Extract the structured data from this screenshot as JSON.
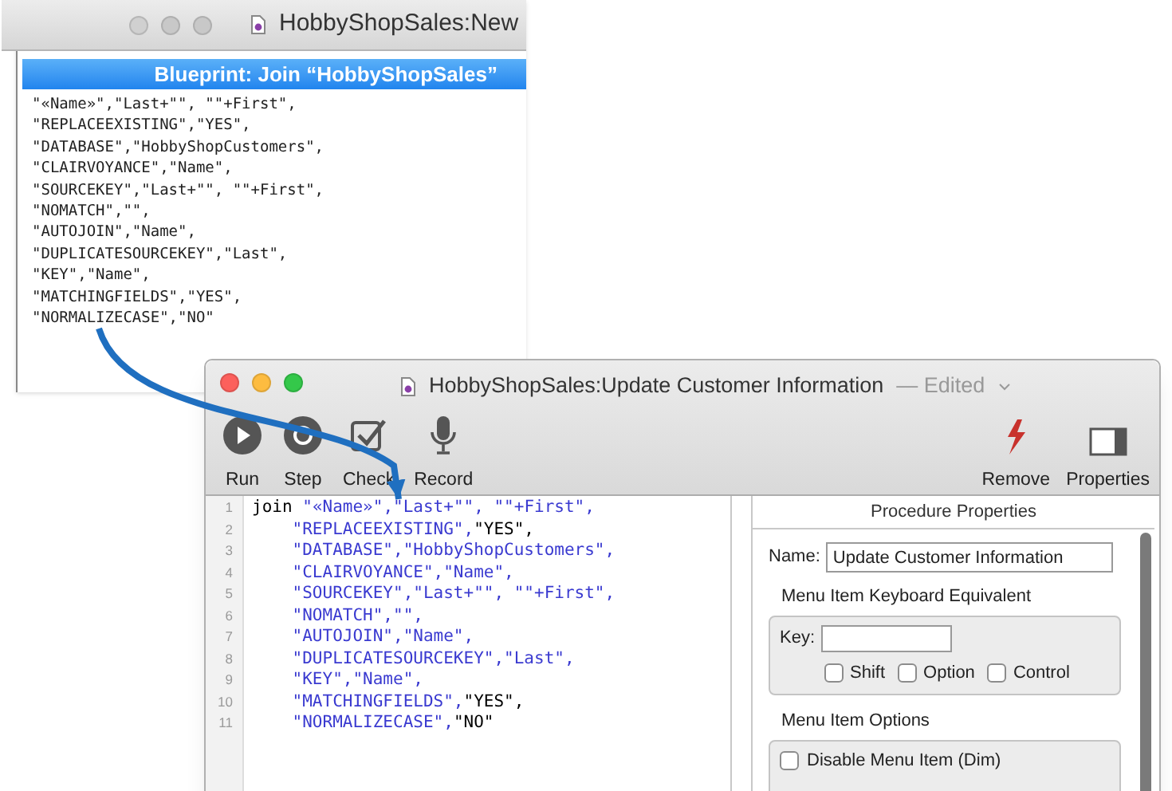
{
  "back_window": {
    "title": "HobbyShopSales:New",
    "panel_title": "Blueprint: Join “HobbyShopSales”",
    "lines": [
      "\"«Name»\",\"Last+\"\", \"\"+First\",",
      "\"REPLACEEXISTING\",\"YES\",",
      "\"DATABASE\",\"HobbyShopCustomers\",",
      "\"CLAIRVOYANCE\",\"Name\",",
      "\"SOURCEKEY\",\"Last+\"\", \"\"+First\",",
      "\"NOMATCH\",\"\",",
      "\"AUTOJOIN\",\"Name\",",
      "\"DUPLICATESOURCEKEY\",\"Last\",",
      "\"KEY\",\"Name\",",
      "\"MATCHINGFIELDS\",\"YES\",",
      "\"NORMALIZECASE\",\"NO\""
    ]
  },
  "front_window": {
    "title": "HobbyShopSales:Update Customer Information",
    "status": "— Edited",
    "toolbar_left": [
      {
        "kind": "run",
        "label": "Run"
      },
      {
        "kind": "step",
        "label": "Step"
      },
      {
        "kind": "check",
        "label": "Check"
      },
      {
        "kind": "record",
        "label": "Record"
      }
    ],
    "toolbar_right": [
      {
        "kind": "remove",
        "label": "Remove"
      },
      {
        "kind": "properties",
        "label": "Properties"
      }
    ],
    "editor": [
      {
        "number": "1",
        "tokens": [
          {
            "kind": "keyword",
            "text": "join"
          },
          {
            "kind": "string",
            "text": " \"«Name»\",\"Last+\"\", \"\"+First\","
          }
        ]
      },
      {
        "number": "2",
        "tokens": [
          {
            "kind": "string",
            "text": "    \"REPLACEEXISTING\","
          },
          {
            "kind": "constant",
            "text": "\"YES\","
          }
        ]
      },
      {
        "number": "3",
        "tokens": [
          {
            "kind": "string",
            "text": "    \"DATABASE\",\"HobbyShopCustomers\","
          }
        ]
      },
      {
        "number": "4",
        "tokens": [
          {
            "kind": "string",
            "text": "    \"CLAIRVOYANCE\",\"Name\","
          }
        ]
      },
      {
        "number": "5",
        "tokens": [
          {
            "kind": "string",
            "text": "    \"SOURCEKEY\",\"Last+\"\", \"\"+First\","
          }
        ]
      },
      {
        "number": "6",
        "tokens": [
          {
            "kind": "string",
            "text": "    \"NOMATCH\",\"\","
          }
        ]
      },
      {
        "number": "7",
        "tokens": [
          {
            "kind": "string",
            "text": "    \"AUTOJOIN\",\"Name\","
          }
        ]
      },
      {
        "number": "8",
        "tokens": [
          {
            "kind": "string",
            "text": "    \"DUPLICATESOURCEKEY\",\"Last\","
          }
        ]
      },
      {
        "number": "9",
        "tokens": [
          {
            "kind": "string",
            "text": "    \"KEY\",\"Name\","
          }
        ]
      },
      {
        "number": "10",
        "tokens": [
          {
            "kind": "string",
            "text": "    \"MATCHINGFIELDS\","
          },
          {
            "kind": "constant",
            "text": "\"YES\","
          }
        ]
      },
      {
        "number": "11",
        "tokens": [
          {
            "kind": "string",
            "text": "    \"NORMALIZECASE\","
          },
          {
            "kind": "constant",
            "text": "\"NO\""
          }
        ]
      }
    ],
    "properties": {
      "header": "Procedure Properties",
      "name_label": "Name:",
      "name_value": "Update Customer Information",
      "keyboard_group": "Menu Item Keyboard Equivalent",
      "key_label": "Key:",
      "modifiers": [
        {
          "label": "Shift",
          "checked": false
        },
        {
          "label": "Option",
          "checked": false
        },
        {
          "label": "Control",
          "checked": false
        }
      ],
      "options_group": "Menu Item Options",
      "options": [
        {
          "label": "Disable Menu Item (Dim)",
          "checked": false
        }
      ]
    }
  }
}
